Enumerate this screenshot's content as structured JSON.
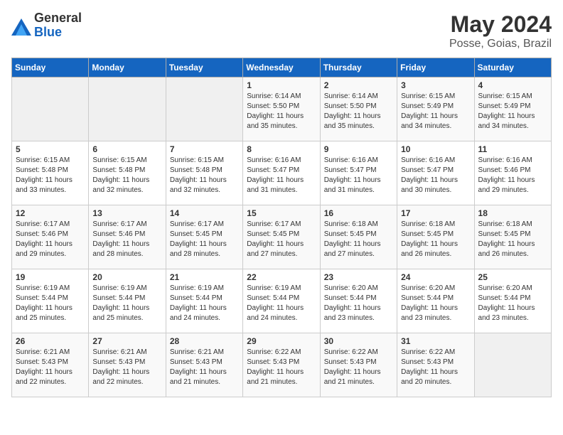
{
  "logo": {
    "general": "General",
    "blue": "Blue"
  },
  "title": "May 2024",
  "location": "Posse, Goias, Brazil",
  "headers": [
    "Sunday",
    "Monday",
    "Tuesday",
    "Wednesday",
    "Thursday",
    "Friday",
    "Saturday"
  ],
  "weeks": [
    [
      {
        "day": "",
        "sunrise": "",
        "sunset": "",
        "daylight": ""
      },
      {
        "day": "",
        "sunrise": "",
        "sunset": "",
        "daylight": ""
      },
      {
        "day": "",
        "sunrise": "",
        "sunset": "",
        "daylight": ""
      },
      {
        "day": "1",
        "sunrise": "Sunrise: 6:14 AM",
        "sunset": "Sunset: 5:50 PM",
        "daylight": "Daylight: 11 hours and 35 minutes."
      },
      {
        "day": "2",
        "sunrise": "Sunrise: 6:14 AM",
        "sunset": "Sunset: 5:50 PM",
        "daylight": "Daylight: 11 hours and 35 minutes."
      },
      {
        "day": "3",
        "sunrise": "Sunrise: 6:15 AM",
        "sunset": "Sunset: 5:49 PM",
        "daylight": "Daylight: 11 hours and 34 minutes."
      },
      {
        "day": "4",
        "sunrise": "Sunrise: 6:15 AM",
        "sunset": "Sunset: 5:49 PM",
        "daylight": "Daylight: 11 hours and 34 minutes."
      }
    ],
    [
      {
        "day": "5",
        "sunrise": "Sunrise: 6:15 AM",
        "sunset": "Sunset: 5:48 PM",
        "daylight": "Daylight: 11 hours and 33 minutes."
      },
      {
        "day": "6",
        "sunrise": "Sunrise: 6:15 AM",
        "sunset": "Sunset: 5:48 PM",
        "daylight": "Daylight: 11 hours and 32 minutes."
      },
      {
        "day": "7",
        "sunrise": "Sunrise: 6:15 AM",
        "sunset": "Sunset: 5:48 PM",
        "daylight": "Daylight: 11 hours and 32 minutes."
      },
      {
        "day": "8",
        "sunrise": "Sunrise: 6:16 AM",
        "sunset": "Sunset: 5:47 PM",
        "daylight": "Daylight: 11 hours and 31 minutes."
      },
      {
        "day": "9",
        "sunrise": "Sunrise: 6:16 AM",
        "sunset": "Sunset: 5:47 PM",
        "daylight": "Daylight: 11 hours and 31 minutes."
      },
      {
        "day": "10",
        "sunrise": "Sunrise: 6:16 AM",
        "sunset": "Sunset: 5:47 PM",
        "daylight": "Daylight: 11 hours and 30 minutes."
      },
      {
        "day": "11",
        "sunrise": "Sunrise: 6:16 AM",
        "sunset": "Sunset: 5:46 PM",
        "daylight": "Daylight: 11 hours and 29 minutes."
      }
    ],
    [
      {
        "day": "12",
        "sunrise": "Sunrise: 6:17 AM",
        "sunset": "Sunset: 5:46 PM",
        "daylight": "Daylight: 11 hours and 29 minutes."
      },
      {
        "day": "13",
        "sunrise": "Sunrise: 6:17 AM",
        "sunset": "Sunset: 5:46 PM",
        "daylight": "Daylight: 11 hours and 28 minutes."
      },
      {
        "day": "14",
        "sunrise": "Sunrise: 6:17 AM",
        "sunset": "Sunset: 5:45 PM",
        "daylight": "Daylight: 11 hours and 28 minutes."
      },
      {
        "day": "15",
        "sunrise": "Sunrise: 6:17 AM",
        "sunset": "Sunset: 5:45 PM",
        "daylight": "Daylight: 11 hours and 27 minutes."
      },
      {
        "day": "16",
        "sunrise": "Sunrise: 6:18 AM",
        "sunset": "Sunset: 5:45 PM",
        "daylight": "Daylight: 11 hours and 27 minutes."
      },
      {
        "day": "17",
        "sunrise": "Sunrise: 6:18 AM",
        "sunset": "Sunset: 5:45 PM",
        "daylight": "Daylight: 11 hours and 26 minutes."
      },
      {
        "day": "18",
        "sunrise": "Sunrise: 6:18 AM",
        "sunset": "Sunset: 5:45 PM",
        "daylight": "Daylight: 11 hours and 26 minutes."
      }
    ],
    [
      {
        "day": "19",
        "sunrise": "Sunrise: 6:19 AM",
        "sunset": "Sunset: 5:44 PM",
        "daylight": "Daylight: 11 hours and 25 minutes."
      },
      {
        "day": "20",
        "sunrise": "Sunrise: 6:19 AM",
        "sunset": "Sunset: 5:44 PM",
        "daylight": "Daylight: 11 hours and 25 minutes."
      },
      {
        "day": "21",
        "sunrise": "Sunrise: 6:19 AM",
        "sunset": "Sunset: 5:44 PM",
        "daylight": "Daylight: 11 hours and 24 minutes."
      },
      {
        "day": "22",
        "sunrise": "Sunrise: 6:19 AM",
        "sunset": "Sunset: 5:44 PM",
        "daylight": "Daylight: 11 hours and 24 minutes."
      },
      {
        "day": "23",
        "sunrise": "Sunrise: 6:20 AM",
        "sunset": "Sunset: 5:44 PM",
        "daylight": "Daylight: 11 hours and 23 minutes."
      },
      {
        "day": "24",
        "sunrise": "Sunrise: 6:20 AM",
        "sunset": "Sunset: 5:44 PM",
        "daylight": "Daylight: 11 hours and 23 minutes."
      },
      {
        "day": "25",
        "sunrise": "Sunrise: 6:20 AM",
        "sunset": "Sunset: 5:44 PM",
        "daylight": "Daylight: 11 hours and 23 minutes."
      }
    ],
    [
      {
        "day": "26",
        "sunrise": "Sunrise: 6:21 AM",
        "sunset": "Sunset: 5:43 PM",
        "daylight": "Daylight: 11 hours and 22 minutes."
      },
      {
        "day": "27",
        "sunrise": "Sunrise: 6:21 AM",
        "sunset": "Sunset: 5:43 PM",
        "daylight": "Daylight: 11 hours and 22 minutes."
      },
      {
        "day": "28",
        "sunrise": "Sunrise: 6:21 AM",
        "sunset": "Sunset: 5:43 PM",
        "daylight": "Daylight: 11 hours and 21 minutes."
      },
      {
        "day": "29",
        "sunrise": "Sunrise: 6:22 AM",
        "sunset": "Sunset: 5:43 PM",
        "daylight": "Daylight: 11 hours and 21 minutes."
      },
      {
        "day": "30",
        "sunrise": "Sunrise: 6:22 AM",
        "sunset": "Sunset: 5:43 PM",
        "daylight": "Daylight: 11 hours and 21 minutes."
      },
      {
        "day": "31",
        "sunrise": "Sunrise: 6:22 AM",
        "sunset": "Sunset: 5:43 PM",
        "daylight": "Daylight: 11 hours and 20 minutes."
      },
      {
        "day": "",
        "sunrise": "",
        "sunset": "",
        "daylight": ""
      }
    ]
  ]
}
